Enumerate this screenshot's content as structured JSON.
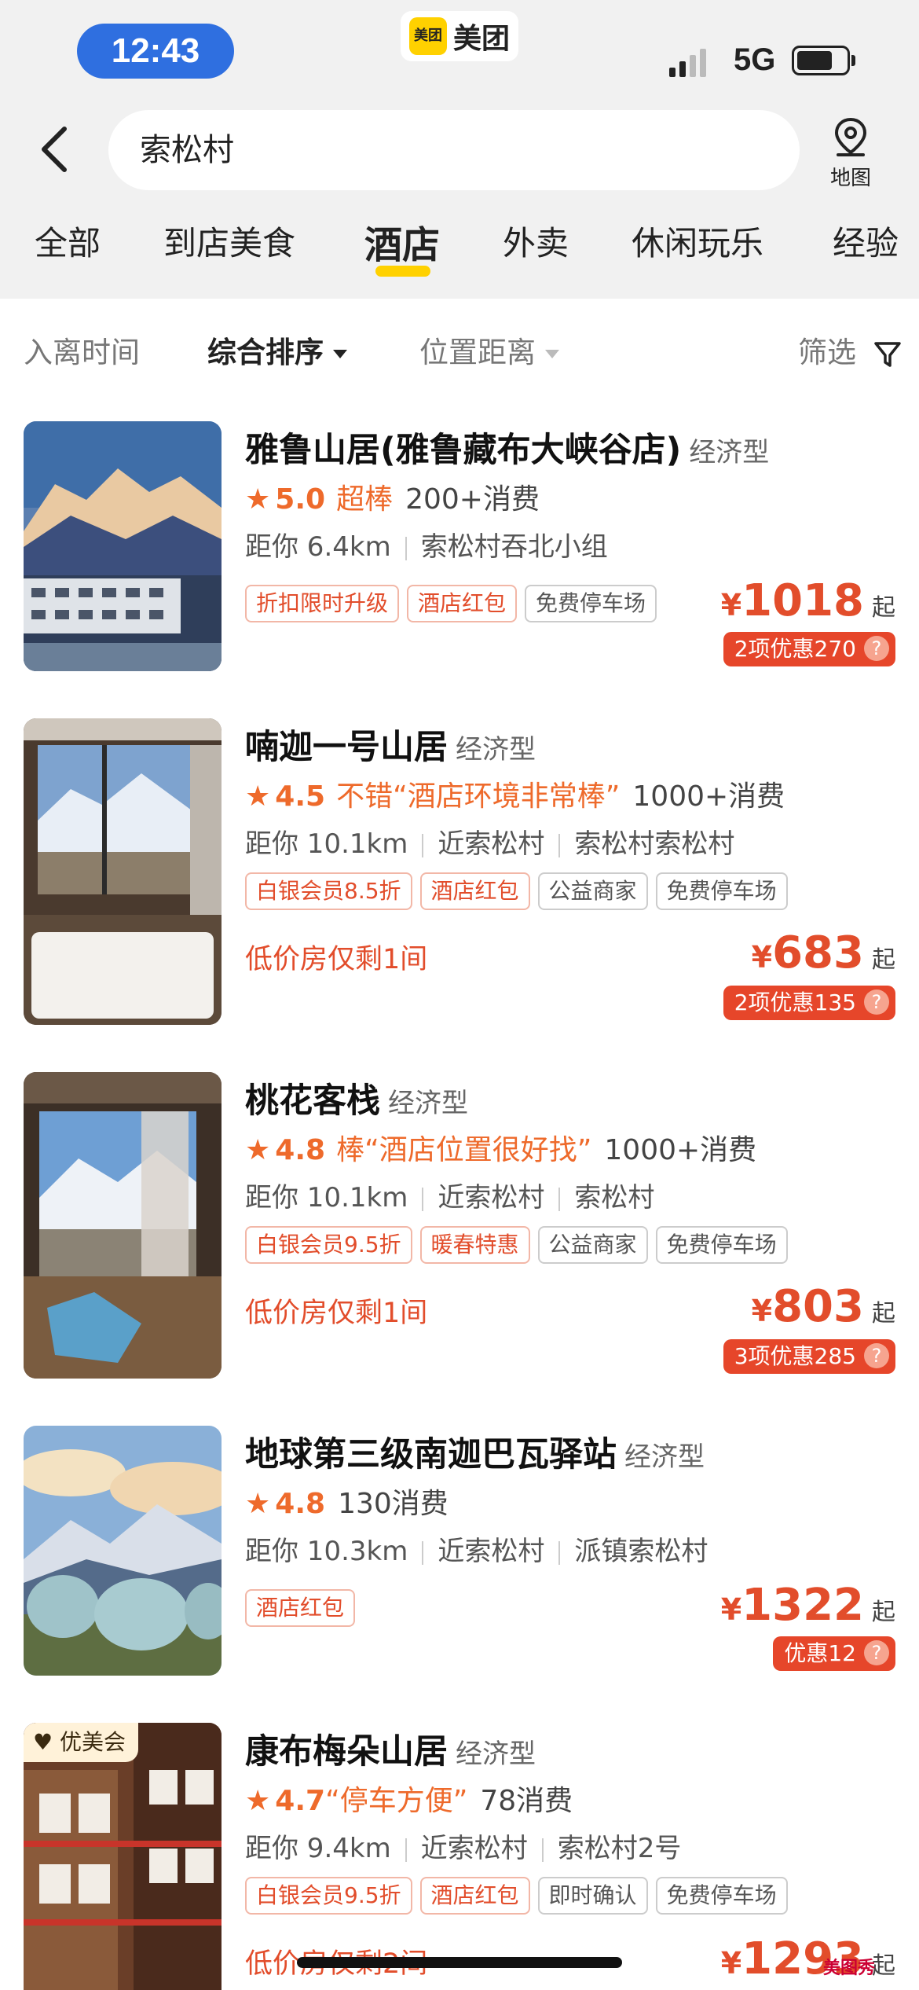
{
  "status_bar": {
    "time": "12:43",
    "network": "5G",
    "app_name": "美团",
    "app_logo_text": "美团"
  },
  "search": {
    "query": "索松村",
    "map_label": "地图"
  },
  "tabs": [
    {
      "label": "全部"
    },
    {
      "label": "到店美食"
    },
    {
      "label": "酒店",
      "active": true
    },
    {
      "label": "外卖"
    },
    {
      "label": "休闲玩乐"
    },
    {
      "label": "经验"
    }
  ],
  "filters": {
    "time": "入离时间",
    "sort": "综合排序",
    "distance": "位置距离",
    "filter": "筛选"
  },
  "colors": {
    "accent": "#e24d2b",
    "brand": "#ffd100",
    "time_pill": "#2f6fe0"
  },
  "hotels": [
    {
      "name": "雅鲁山居(雅鲁藏布大峡谷店)",
      "type": "经济型",
      "score": "5.0",
      "rating_word": "超棒",
      "review_quote": "",
      "consumption": "200+消费",
      "distance": "距你 6.4km",
      "locations": [
        "索松村吞北小组"
      ],
      "tags": [
        {
          "text": "折扣限时升级",
          "style": "red"
        },
        {
          "text": "酒店红包",
          "style": "red"
        },
        {
          "text": "免费停车场",
          "style": "grey"
        }
      ],
      "scarce": "",
      "price_symbol": "¥",
      "price": "1018",
      "price_suffix": "起",
      "promo": "2项优惠270",
      "badge": ""
    },
    {
      "name": "喃迦一号山居",
      "type": "经济型",
      "score": "4.5",
      "rating_word": "不错",
      "review_quote": "“酒店环境非常棒”",
      "consumption": "1000+消费",
      "distance": "距你 10.1km",
      "locations": [
        "近索松村",
        "索松村索松村"
      ],
      "tags": [
        {
          "text": "白银会员8.5折",
          "style": "red"
        },
        {
          "text": "酒店红包",
          "style": "red"
        },
        {
          "text": "公益商家",
          "style": "grey"
        },
        {
          "text": "免费停车场",
          "style": "grey"
        }
      ],
      "scarce": "低价房仅剩1间",
      "price_symbol": "¥",
      "price": "683",
      "price_suffix": "起",
      "promo": "2项优惠135",
      "badge": ""
    },
    {
      "name": "桃花客栈",
      "type": "经济型",
      "score": "4.8",
      "rating_word": "棒",
      "review_quote": "“酒店位置很好找”",
      "consumption": "1000+消费",
      "distance": "距你 10.1km",
      "locations": [
        "近索松村",
        "索松村"
      ],
      "tags": [
        {
          "text": "白银会员9.5折",
          "style": "red"
        },
        {
          "text": "暖春特惠",
          "style": "red"
        },
        {
          "text": "公益商家",
          "style": "grey"
        },
        {
          "text": "免费停车场",
          "style": "grey"
        }
      ],
      "scarce": "低价房仅剩1间",
      "price_symbol": "¥",
      "price": "803",
      "price_suffix": "起",
      "promo": "3项优惠285",
      "badge": ""
    },
    {
      "name": "地球第三级南迦巴瓦驿站",
      "type": "经济型",
      "score": "4.8",
      "rating_word": "",
      "review_quote": "",
      "consumption": "130消费",
      "distance": "距你 10.3km",
      "locations": [
        "近索松村",
        "派镇索松村"
      ],
      "tags": [
        {
          "text": "酒店红包",
          "style": "red"
        }
      ],
      "scarce": "",
      "price_symbol": "¥",
      "price": "1322",
      "price_suffix": "起",
      "promo": "优惠12",
      "badge": ""
    },
    {
      "name": "康布梅朵山居",
      "type": "经济型",
      "score": "4.7",
      "rating_word": "",
      "review_quote": "“停车方便”",
      "consumption": "78消费",
      "distance": "距你 9.4km",
      "locations": [
        "近索松村",
        "索松村2号"
      ],
      "tags": [
        {
          "text": "白银会员9.5折",
          "style": "red"
        },
        {
          "text": "酒店红包",
          "style": "red"
        },
        {
          "text": "即时确认",
          "style": "grey"
        },
        {
          "text": "免费停车场",
          "style": "grey"
        }
      ],
      "scarce": "低价房仅剩2间",
      "price_symbol": "¥",
      "price": "1293",
      "price_suffix": "起",
      "promo": "",
      "badge": "优美会"
    }
  ],
  "watermark": "美图秀"
}
